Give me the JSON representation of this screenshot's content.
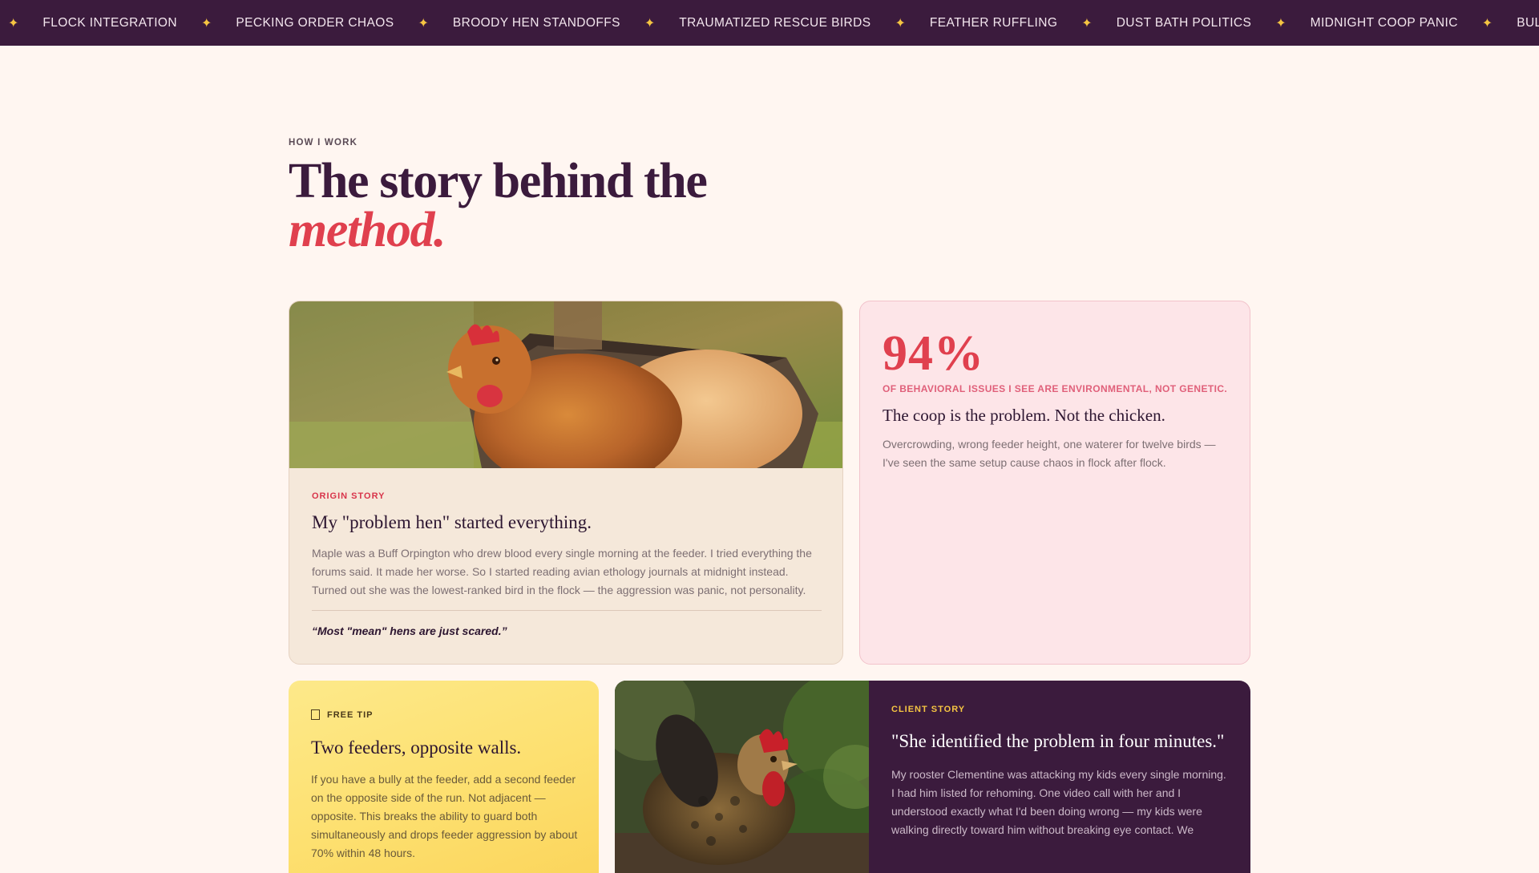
{
  "ticker": {
    "items": [
      "FLOCK INTEGRATION",
      "PECKING ORDER CHAOS",
      "BROODY HEN STANDOFFS",
      "TRAUMATIZED RESCUE BIRDS",
      "FEATHER RUFFLING",
      "DUST BATH POLITICS",
      "MIDNIGHT COOP PANIC",
      "BULLY AT THE FEEDER"
    ],
    "separator": "✦"
  },
  "header": {
    "eyebrow": "HOW I WORK",
    "title_line1": "The story behind the",
    "title_accent": "method."
  },
  "origin": {
    "tag": "ORIGIN STORY",
    "title": "My \"problem hen\" started everything.",
    "text": "Maple was a Buff Orpington who drew blood every single morning at the feeder. I tried everything the forums said. It made her worse. So I started reading avian ethology journals at midnight instead. Turned out she was the lowest-ranked bird in the flock — the aggression was panic, not personality.",
    "quote": "“Most \"mean\" hens are just scared.”"
  },
  "stat": {
    "value": "94%",
    "caption": "OF BEHAVIORAL ISSUES I SEE ARE ENVIRONMENTAL, NOT GENETIC.",
    "title": "The coop is the problem. Not the chicken.",
    "text": "Overcrowding, wrong feeder height, one waterer for twelve birds — I've seen the same setup cause chaos in flock after flock."
  },
  "tip": {
    "tag": "FREE TIP",
    "title": "Two feeders, opposite walls.",
    "text": "If you have a bully at the feeder, add a second feeder on the opposite side of the run. Not adjacent — opposite. This breaks the ability to guard both simultaneously and drops feeder aggression by about 70% within 48 hours."
  },
  "client": {
    "tag": "CLIENT STORY",
    "quote": "\"She identified the problem in four minutes.\"",
    "text": "My rooster Clementine was attacking my kids every single morning. I had him listed for rehoming. One video call with her and I understood exactly what I'd been doing wrong — my kids were walking directly toward him without breaking eye contact. We"
  },
  "colors": {
    "nav_bg": "#3b1b3d",
    "accent_red": "#e0404e",
    "star_gold": "#f5c542",
    "page_bg": "#fff6f1"
  }
}
